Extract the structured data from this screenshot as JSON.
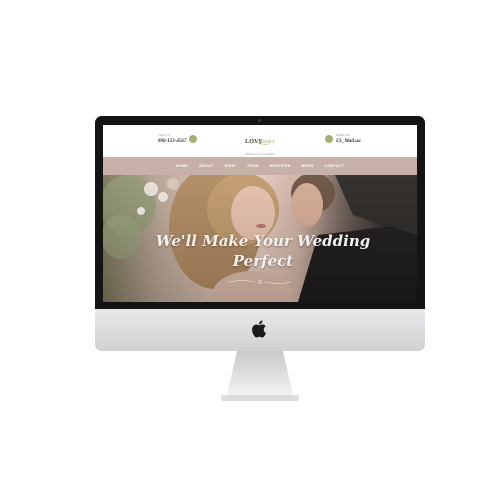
{
  "header": {
    "call": {
      "label": "Call Us!",
      "value": "800-123-4567",
      "icon": "phone-icon"
    },
    "logo": {
      "main": "LOVE",
      "script": "story",
      "tagline": "WEDDING PLANNER"
    },
    "email": {
      "label": "Email Us!",
      "value": "LS_Mail.ua",
      "icon": "mail-icon"
    }
  },
  "nav": {
    "items": [
      "HOME",
      "ABOUT",
      "SHOP",
      "TEAM",
      "SERVICES",
      "NEWS",
      "CONTACT"
    ]
  },
  "hero": {
    "line1": "We'll Make Your Wedding",
    "line2": "Perfect"
  },
  "colors": {
    "accent_green": "#a6b06e",
    "nav_bg": "#c7b0a7",
    "bezel": "#141414"
  }
}
